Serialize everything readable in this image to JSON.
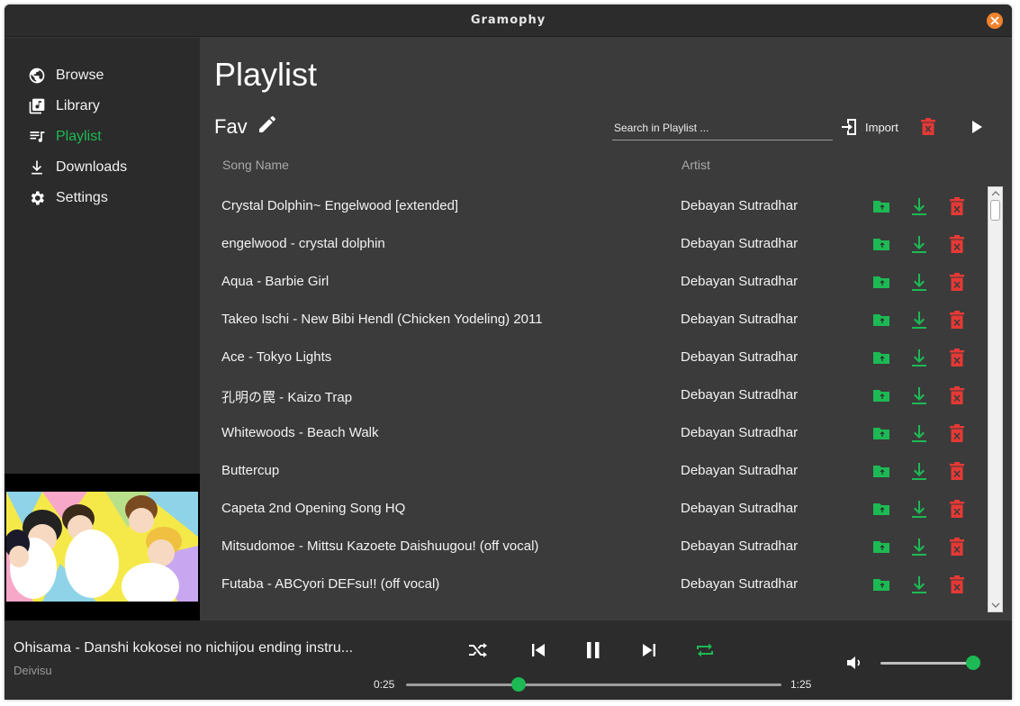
{
  "window": {
    "title": "Gramophy"
  },
  "colors": {
    "accent": "#1db954",
    "delete": "#e53935",
    "close": "#f0822d"
  },
  "sidebar": {
    "items": [
      {
        "label": "Browse",
        "icon": "globe-icon",
        "active": false
      },
      {
        "label": "Library",
        "icon": "library-icon",
        "active": false
      },
      {
        "label": "Playlist",
        "icon": "playlist-icon",
        "active": true
      },
      {
        "label": "Downloads",
        "icon": "download-icon",
        "active": false
      },
      {
        "label": "Settings",
        "icon": "gear-icon",
        "active": false
      }
    ]
  },
  "main": {
    "title": "Playlist",
    "playlist_name": "Fav",
    "search_placeholder": "Search in Playlist ...",
    "import_label": "Import",
    "columns": {
      "song": "Song Name",
      "artist": "Artist"
    },
    "rows": [
      {
        "song": "Crystal Dolphin~ Engelwood [extended]",
        "artist": "Debayan Sutradhar"
      },
      {
        "song": "engelwood - crystal dolphin",
        "artist": "Debayan Sutradhar"
      },
      {
        "song": "Aqua - Barbie Girl",
        "artist": "Debayan Sutradhar"
      },
      {
        "song": "Takeo Ischi - New Bibi Hendl (Chicken Yodeling) 2011",
        "artist": "Debayan Sutradhar"
      },
      {
        "song": "Ace - Tokyo Lights",
        "artist": "Debayan Sutradhar"
      },
      {
        "song": "孔明の罠 - Kaizo Trap",
        "artist": "Debayan Sutradhar"
      },
      {
        "song": "Whitewoods - Beach Walk",
        "artist": "Debayan Sutradhar"
      },
      {
        "song": "Buttercup",
        "artist": "Debayan Sutradhar"
      },
      {
        "song": "Capeta 2nd Opening Song HQ",
        "artist": "Debayan Sutradhar"
      },
      {
        "song": "Mitsudomoe - Mittsu Kazoete Daishuugou! (off vocal)",
        "artist": "Debayan Sutradhar"
      },
      {
        "song": "Futaba - ABCyori DEFsu!! (off vocal)",
        "artist": "Debayan Sutradhar"
      }
    ]
  },
  "player": {
    "title": "Ohisama - Danshi kokosei no nichijou ending instru...",
    "artist": "Deivisu",
    "current_time": "0:25",
    "total_time": "1:25",
    "progress": 0.3,
    "volume": 1.0,
    "repeat_active": true
  }
}
